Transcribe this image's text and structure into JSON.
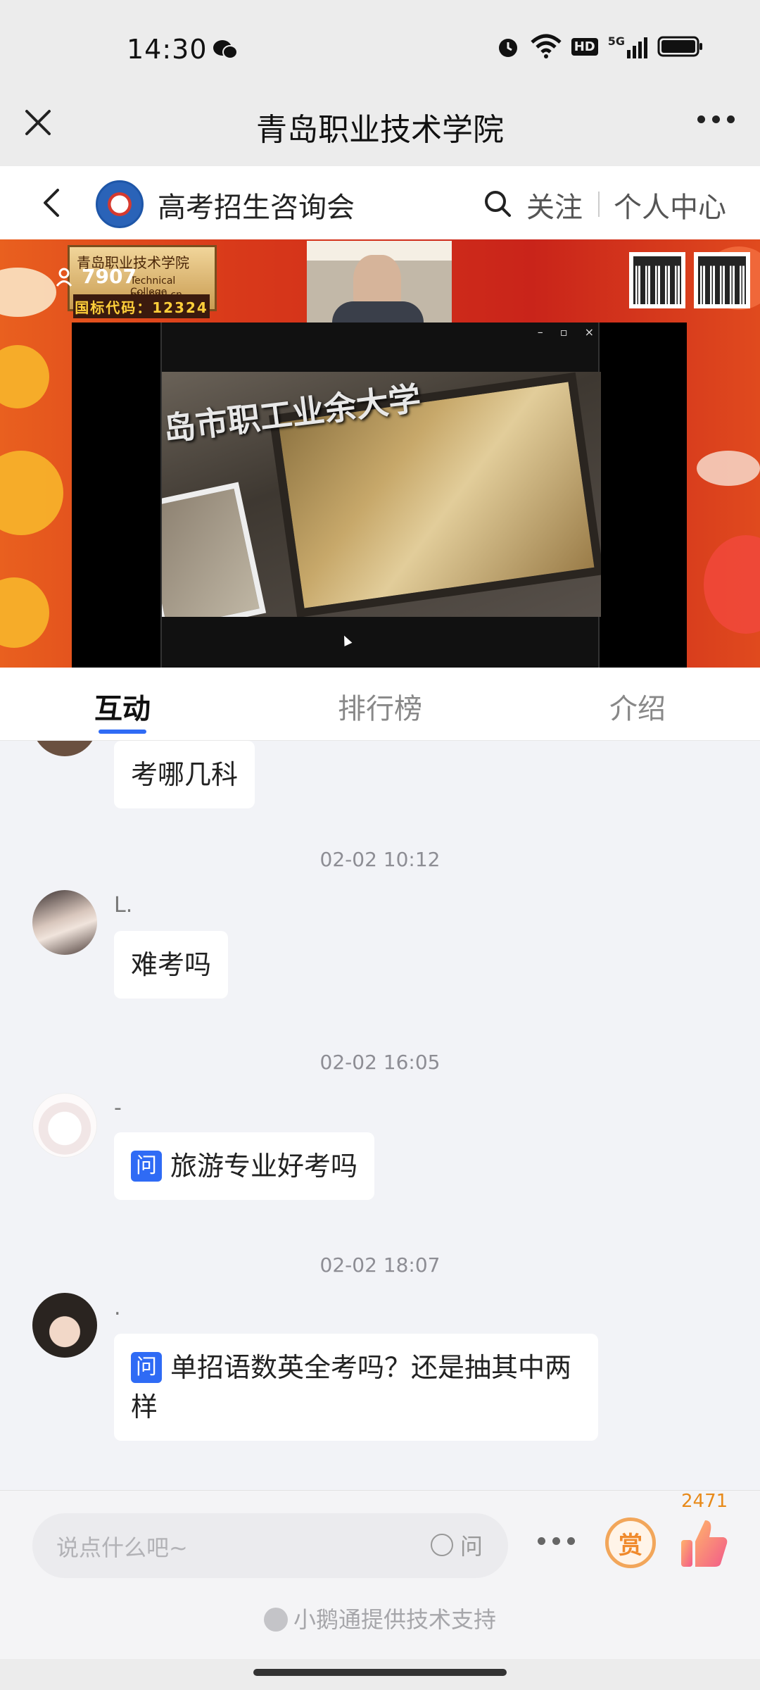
{
  "status_bar": {
    "time": "14:30",
    "icons": [
      "wechat-icon",
      "alarm-icon",
      "wifi-icon",
      "hd-icon",
      "5g-signal-icon",
      "battery-icon"
    ],
    "hd_label": "HD",
    "net_label": "5G"
  },
  "title_bar": {
    "title": "青岛职业技术学院"
  },
  "channel": {
    "name": "高考招生咨询会",
    "follow_label": "关注",
    "profile_label": "个人中心"
  },
  "video": {
    "viewer_count": "7907",
    "banner_title": "青岛职业技术学院",
    "banner_sub": "Technical College",
    "banner_url": "qtc.edu.cn",
    "code_label": "国标代码：12324",
    "slide_text": "岛市职工业余大学"
  },
  "tabs": {
    "items": [
      {
        "label": "互动"
      },
      {
        "label": "排行榜"
      },
      {
        "label": "介绍"
      }
    ],
    "active_index": 0
  },
  "chat": {
    "messages": [
      {
        "text": "考哪几科"
      },
      {
        "time": "02-02 10:12",
        "user": "L.",
        "text": "难考吗"
      },
      {
        "time": "02-02 16:05",
        "user": "-",
        "badge": "问",
        "text": "旅游专业好考吗"
      },
      {
        "time": "02-02 18:07",
        "user": ".",
        "badge": "问",
        "text": "单招语数英全考吗？还是抽其中两样"
      }
    ]
  },
  "bottom": {
    "input_placeholder": "说点什么吧~",
    "question_toggle": "问",
    "reward_label": "赏",
    "like_count": "2471",
    "powered_by": "小鹅通提供技术支持"
  },
  "colors": {
    "accent": "#2f6bf5",
    "reward": "#f08a2c",
    "background": "#f2f3f7"
  }
}
